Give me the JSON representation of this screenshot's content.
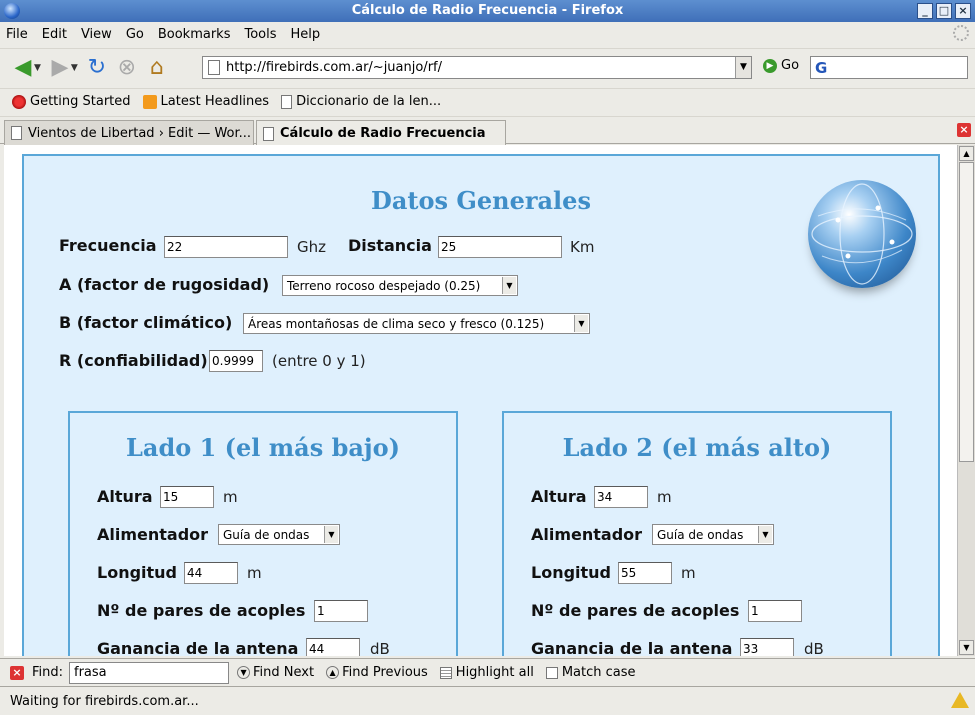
{
  "window": {
    "title": "Cálculo de Radio Frecuencia - Firefox"
  },
  "menu": [
    "File",
    "Edit",
    "View",
    "Go",
    "Bookmarks",
    "Tools",
    "Help"
  ],
  "nav": {
    "url": "http://firebirds.com.ar/~juanjo/rf/",
    "go_label": "Go",
    "search_value": ""
  },
  "bookmarks": [
    {
      "label": "Getting Started",
      "icon": "firefox-icon"
    },
    {
      "label": "Latest Headlines",
      "icon": "rss-feed-icon"
    },
    {
      "label": "Diccionario de la len...",
      "icon": "page-icon"
    }
  ],
  "tabs": [
    {
      "label": "Vientos de Libertad › Edit — Wor...",
      "active": false
    },
    {
      "label": "Cálculo de Radio Frecuencia",
      "active": true
    }
  ],
  "page": {
    "general": {
      "heading": "Datos Generales",
      "frecuencia_label": "Frecuencia",
      "frecuencia_value": "22",
      "frecuencia_unit": "Ghz",
      "distancia_label": "Distancia",
      "distancia_value": "25",
      "distancia_unit": "Km",
      "a_label": "A (factor de rugosidad)",
      "a_value": "Terreno rocoso despejado (0.25)",
      "b_label": "B (factor climático)",
      "b_value": "Áreas montañosas de clima seco y fresco (0.125)",
      "r_label": "R (confiabilidad)",
      "r_value": "0.9999",
      "r_hint": "(entre 0 y 1)"
    },
    "lado1": {
      "heading": "Lado 1 (el más bajo)",
      "altura_label": "Altura",
      "altura_value": "15",
      "altura_unit": "m",
      "alimentador_label": "Alimentador",
      "alimentador_value": "Guía de ondas",
      "longitud_label": "Longitud",
      "longitud_value": "44",
      "longitud_unit": "m",
      "acoples_label": "Nº de pares de acoples",
      "acoples_value": "1",
      "ganancia_label": "Ganancia de la antena",
      "ganancia_value": "44",
      "ganancia_unit": "dB"
    },
    "lado2": {
      "heading": "Lado 2 (el más alto)",
      "altura_label": "Altura",
      "altura_value": "34",
      "altura_unit": "m",
      "alimentador_label": "Alimentador",
      "alimentador_value": "Guía de ondas",
      "longitud_label": "Longitud",
      "longitud_value": "55",
      "longitud_unit": "m",
      "acoples_label": "Nº de pares de acoples",
      "acoples_value": "1",
      "ganancia_label": "Ganancia de la antena",
      "ganancia_value": "33",
      "ganancia_unit": "dB"
    }
  },
  "findbar": {
    "label": "Find:",
    "value": "frasa",
    "next": "Find Next",
    "previous": "Find Previous",
    "highlight": "Highlight all",
    "match_case": "Match case"
  },
  "status": {
    "text": "Waiting for firebirds.com.ar..."
  },
  "colors": {
    "accent": "#3f8ec8",
    "panel_bg": "#dff0fd",
    "panel_border": "#5aa7d8"
  }
}
